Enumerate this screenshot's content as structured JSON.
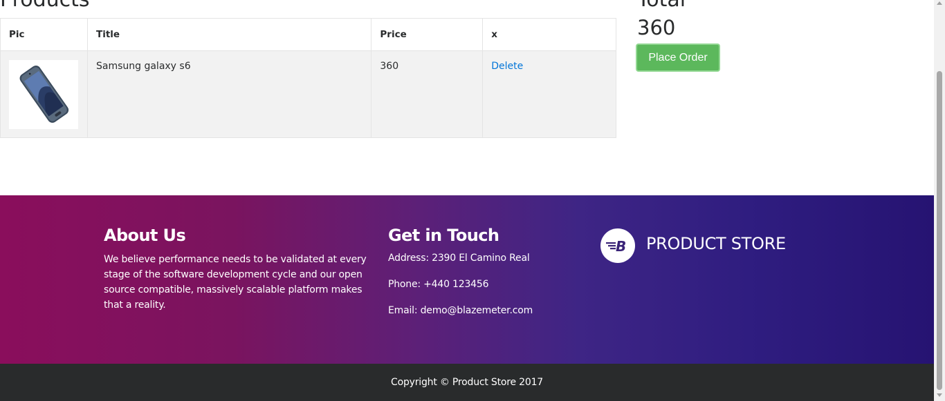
{
  "cart": {
    "heading": "Products",
    "columns": [
      "Pic",
      "Title",
      "Price",
      "x"
    ],
    "rows": [
      {
        "image_icon": "samsung-galaxy-s6-phone",
        "title": "Samsung galaxy s6",
        "price": "360",
        "action": "Delete"
      }
    ]
  },
  "summary": {
    "total_label": "Total",
    "total_value": "360",
    "place_order_label": "Place Order"
  },
  "footer": {
    "about_title": "About Us",
    "about_text": "We believe performance needs to be validated at every stage of the software development cycle and our open source compatible, massively scalable platform makes that a reality.",
    "touch_title": "Get in Touch",
    "address": "Address: 2390 El Camino Real",
    "phone": "Phone: +440 123456",
    "email": "Email: demo@blazemeter.com",
    "brand_name": "PRODUCT STORE",
    "brand_icon": "blazemeter-b-logo"
  },
  "copyright": "Copyright © Product Store 2017",
  "colors": {
    "accent_green": "#5cb85c",
    "link_blue": "#0275d8",
    "footer_gradient_start": "#8a0e5c",
    "footer_gradient_end": "#261372",
    "copyright_bg": "#292b2c"
  }
}
